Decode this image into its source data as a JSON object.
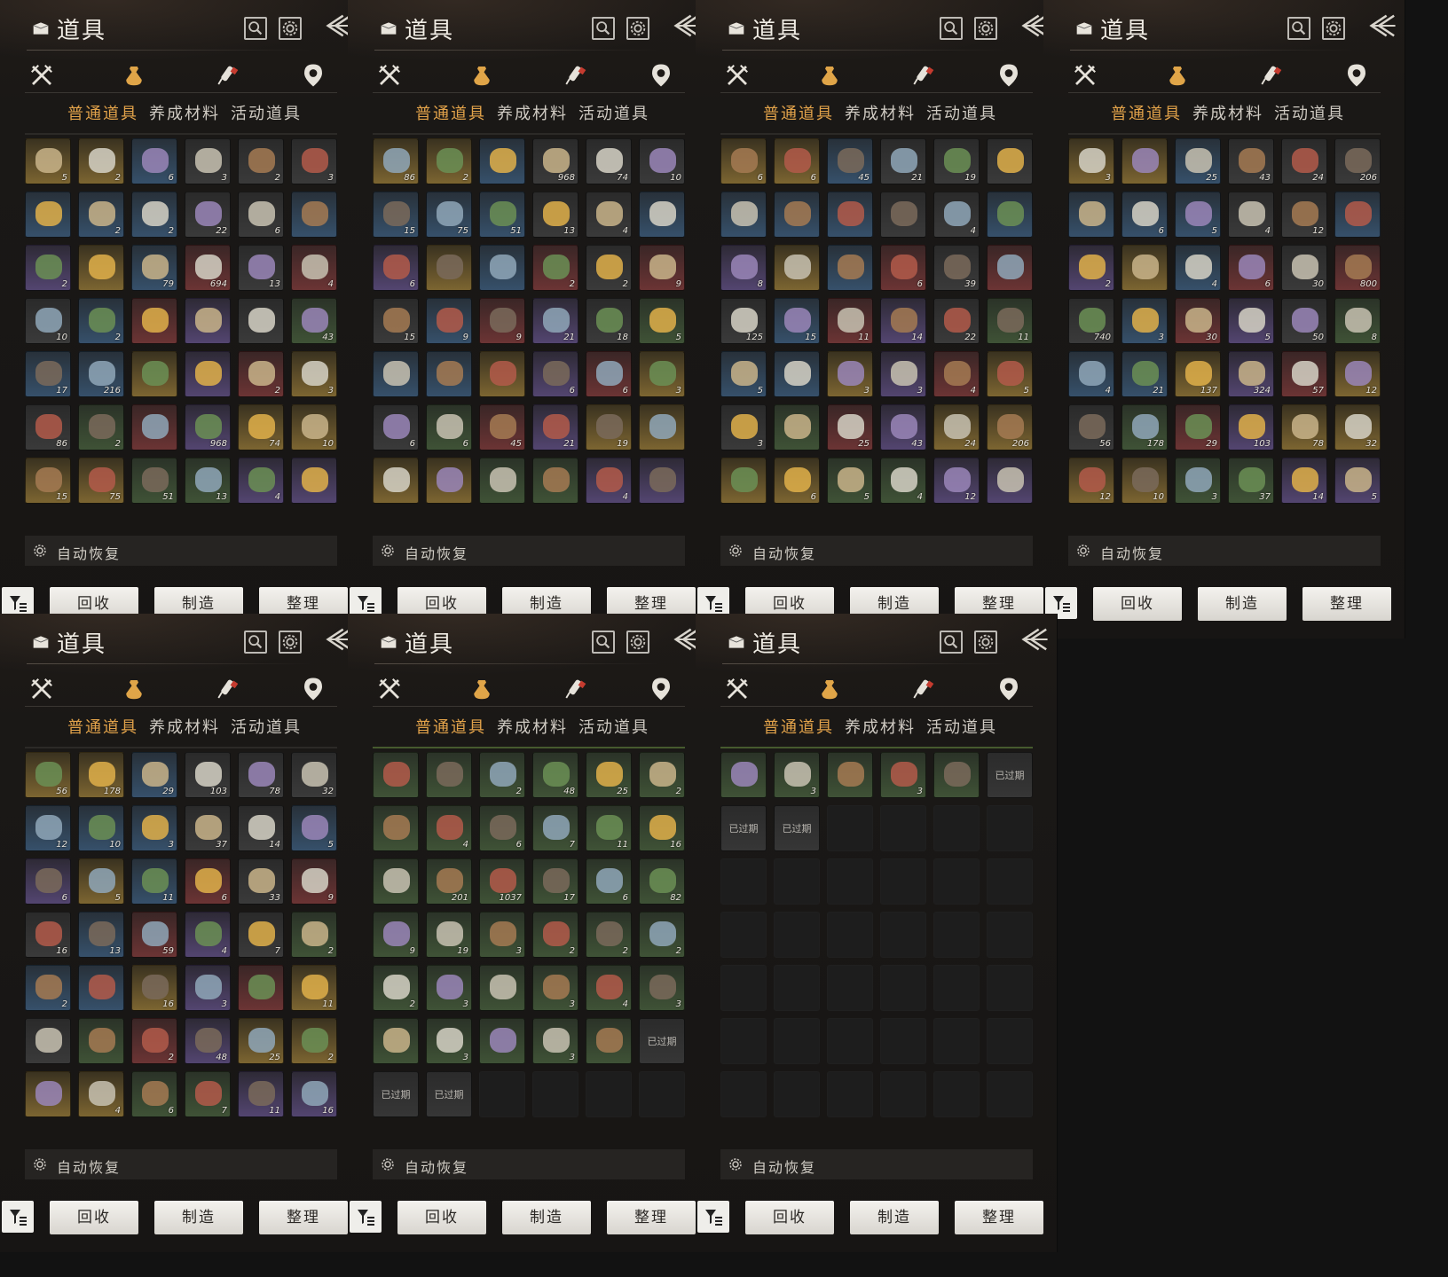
{
  "ui": {
    "title": "道具",
    "sub_tabs": [
      "普通道具",
      "养成材料",
      "活动道具"
    ],
    "auto_recover_label": "自动恢复",
    "buttons": {
      "recycle": "回收",
      "craft": "制造",
      "sort": "整理"
    },
    "icons": {
      "header": "bag-icon",
      "search": "search-icon",
      "settings": "gear-icon",
      "back": "back-arrow-icon",
      "categories": [
        "crossed-swords-icon",
        "money-pouch-icon",
        "firecracker-icon",
        "map-pin-icon"
      ],
      "auto": "gear-icon",
      "filter": "filter-icon"
    },
    "colors": {
      "active_tab": "#e1a24a",
      "text": "#cfcac2"
    }
  },
  "panels": [
    {
      "grid": [
        [
          "5",
          "2",
          "6",
          "3",
          "2",
          "3"
        ],
        [
          "",
          "2",
          "2",
          "22",
          "6",
          ""
        ],
        [
          "2",
          "",
          "79",
          "694",
          "13",
          "4"
        ],
        [
          "10",
          "2",
          "",
          "",
          "",
          "43"
        ],
        [
          "17",
          "216",
          "",
          "",
          "2",
          "3"
        ],
        [
          "86",
          "2",
          "",
          "968",
          "74",
          "10"
        ],
        [
          "15",
          "75",
          "51",
          "13",
          "4",
          ""
        ]
      ],
      "expired": [],
      "empty": []
    },
    {
      "grid": [
        [
          "86",
          "2",
          "",
          "968",
          "74",
          "10"
        ],
        [
          "15",
          "75",
          "51",
          "13",
          "4",
          ""
        ],
        [
          "6",
          "",
          "",
          "2",
          "2",
          "9"
        ],
        [
          "15",
          "9",
          "9",
          "21",
          "18",
          "5"
        ],
        [
          "",
          "",
          "",
          "6",
          "6",
          "3"
        ],
        [
          "6",
          "6",
          "45",
          "21",
          "19",
          ""
        ],
        [
          "",
          "",
          "",
          "",
          "4",
          ""
        ]
      ],
      "expired": [],
      "empty": []
    },
    {
      "grid": [
        [
          "6",
          "6",
          "45",
          "21",
          "19",
          ""
        ],
        [
          "",
          "",
          "",
          "",
          "4",
          ""
        ],
        [
          "8",
          "",
          "",
          "6",
          "39",
          ""
        ],
        [
          "125",
          "15",
          "11",
          "14",
          "22",
          "11"
        ],
        [
          "5",
          "",
          "3",
          "3",
          "4",
          "5"
        ],
        [
          "3",
          "",
          "25",
          "43",
          "24",
          "206"
        ],
        [
          "",
          "6",
          "5",
          "4",
          "12",
          ""
        ]
      ],
      "expired": [],
      "empty": []
    },
    {
      "grid": [
        [
          "3",
          "",
          "25",
          "43",
          "24",
          "206"
        ],
        [
          "",
          "6",
          "5",
          "4",
          "12",
          ""
        ],
        [
          "2",
          "",
          "4",
          "6",
          "30",
          "800"
        ],
        [
          "740",
          "3",
          "30",
          "5",
          "50",
          "8"
        ],
        [
          "4",
          "21",
          "137",
          "324",
          "57",
          "12"
        ],
        [
          "56",
          "178",
          "29",
          "103",
          "78",
          "32"
        ],
        [
          "12",
          "10",
          "3",
          "37",
          "14",
          "5"
        ]
      ],
      "expired": [],
      "empty": []
    },
    {
      "grid": [
        [
          "56",
          "178",
          "29",
          "103",
          "78",
          "32"
        ],
        [
          "12",
          "10",
          "3",
          "37",
          "14",
          "5"
        ],
        [
          "6",
          "5",
          "11",
          "6",
          "33",
          "9"
        ],
        [
          "16",
          "13",
          "59",
          "4",
          "7",
          "2"
        ],
        [
          "2",
          "",
          "16",
          "3",
          "",
          "11"
        ],
        [
          "",
          "",
          "2",
          "48",
          "25",
          "2"
        ],
        [
          "",
          "4",
          "6",
          "7",
          "11",
          "16"
        ]
      ],
      "expired": [],
      "empty": []
    },
    {
      "grid": [
        [
          "",
          "",
          "2",
          "48",
          "25",
          "2"
        ],
        [
          "",
          "4",
          "6",
          "7",
          "11",
          "16"
        ],
        [
          "",
          "201",
          "1037",
          "17",
          "6",
          "82"
        ],
        [
          "9",
          "19",
          "3",
          "2",
          "2",
          "2"
        ],
        [
          "2",
          "3",
          "",
          "3",
          "4",
          "3"
        ],
        [
          "",
          "3",
          "",
          "3",
          "",
          ""
        ],
        [
          "",
          "",
          "",
          "",
          "",
          ""
        ]
      ],
      "expired": [
        [
          5,
          5
        ],
        [
          6,
          0
        ],
        [
          6,
          1
        ]
      ],
      "empty": [
        [
          6,
          2
        ],
        [
          6,
          3
        ],
        [
          6,
          4
        ],
        [
          6,
          5
        ]
      ]
    },
    {
      "grid": [
        [
          "",
          "3",
          "",
          "3",
          "",
          ""
        ],
        [
          "",
          "",
          "",
          "",
          "",
          ""
        ],
        [
          "",
          "",
          "",
          "",
          "",
          ""
        ],
        [
          "",
          "",
          "",
          "",
          "",
          ""
        ],
        [
          "",
          "",
          "",
          "",
          "",
          ""
        ],
        [
          "",
          "",
          "",
          "",
          "",
          ""
        ],
        [
          "",
          "",
          "",
          "",
          "",
          ""
        ]
      ],
      "expired": [
        [
          0,
          5
        ],
        [
          1,
          0
        ],
        [
          1,
          1
        ]
      ],
      "empty": "rest"
    }
  ],
  "expired_label": "已过期"
}
